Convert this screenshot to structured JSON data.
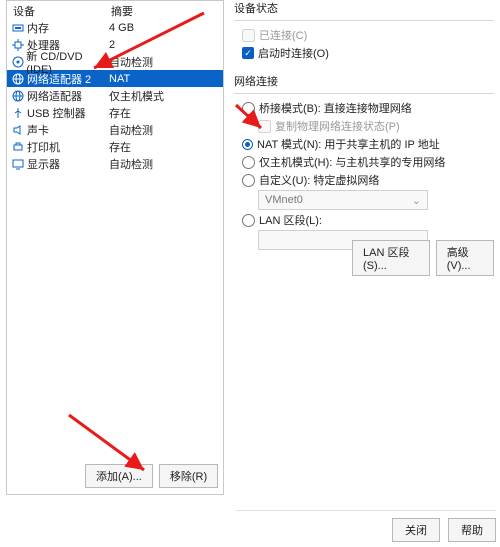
{
  "left": {
    "h_device": "设备",
    "h_summary": "摘要",
    "rows": [
      {
        "icon": "memory-icon",
        "label": "内存",
        "value": "4 GB",
        "sel": false
      },
      {
        "icon": "cpu-icon",
        "label": "处理器",
        "value": "2",
        "sel": false
      },
      {
        "icon": "cd-icon",
        "label": "新 CD/DVD (IDE)",
        "value": "自动检测",
        "sel": false
      },
      {
        "icon": "net-icon",
        "label": "网络适配器 2",
        "value": "NAT",
        "sel": true
      },
      {
        "icon": "net-icon",
        "label": "网络适配器",
        "value": "仅主机模式",
        "sel": false
      },
      {
        "icon": "usb-icon",
        "label": "USB 控制器",
        "value": "存在",
        "sel": false
      },
      {
        "icon": "sound-icon",
        "label": "声卡",
        "value": "自动检测",
        "sel": false
      },
      {
        "icon": "printer-icon",
        "label": "打印机",
        "value": "存在",
        "sel": false
      },
      {
        "icon": "display-icon",
        "label": "显示器",
        "value": "自动检测",
        "sel": false
      }
    ],
    "add_btn": "添加(A)...",
    "remove_btn": "移除(R)"
  },
  "right": {
    "status_title": "设备状态",
    "connected": "已连接(C)",
    "connect_on": "启动时连接(O)",
    "net_title": "网络连接",
    "bridge": "桥接模式(B): 直接连接物理网络",
    "replicate": "复制物理网络连接状态(P)",
    "nat": "NAT 模式(N): 用于共享主机的 IP 地址",
    "hostonly": "仅主机模式(H): 与主机共享的专用网络",
    "custom": "自定义(U): 特定虚拟网络",
    "vnet": "VMnet0",
    "lan": "LAN 区段(L):",
    "lan_btn": "LAN 区段(S)...",
    "adv_btn": "高级(V)..."
  },
  "footer": {
    "close": "关闭",
    "help": "帮助"
  }
}
